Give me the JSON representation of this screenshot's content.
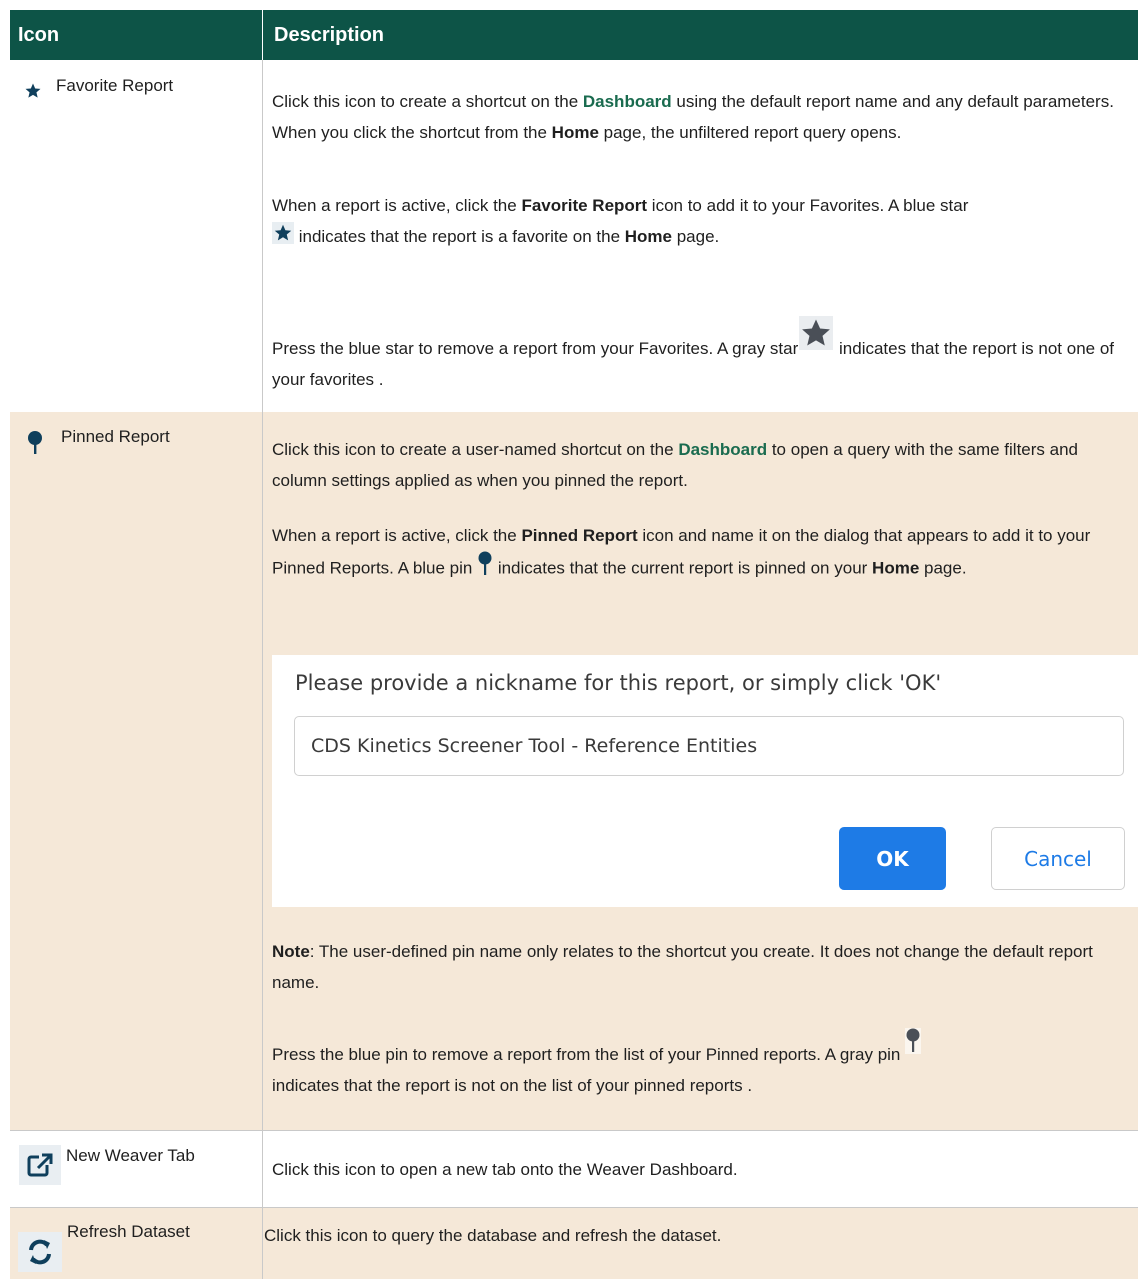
{
  "header": {
    "col_icon": "Icon",
    "col_description": "Description"
  },
  "rows": {
    "favorite": {
      "icon": "star-icon",
      "label": "Favorite Report",
      "p1_a": "Click this icon to create a shortcut on the ",
      "p1_link": "Dashboard",
      "p1_b": " using the default report name and any default parameters. When you click the shortcut from the ",
      "p1_bold": "Home",
      "p1_c": " page, the unfiltered report query opens.",
      "p2_a": "When a report is active, click the ",
      "p2_bold": "Favorite Report",
      "p2_b": " icon to add it to your Favorites. A blue star",
      "p2_c": " indicates that the report is a favorite on the ",
      "p2_bold2": "Home",
      "p2_d": " page.",
      "p3_a": "Press the blue star to remove a report from your Favorites. A gray star",
      "p3_b": " indicates that the report is not one of your favorites ."
    },
    "pinned": {
      "icon": "pin-icon",
      "label": "Pinned Report",
      "p1_a": "Click this icon to create a user-named shortcut on the ",
      "p1_link": "Dashboard",
      "p1_b": " to open a query with the same filters and column settings applied as when you pinned the report.",
      "p2_a": "When a report is active, click the ",
      "p2_bold": "Pinned Report",
      "p2_b": " icon and name it on the dialog that appears to add it to your Pinned Reports. A blue pin ",
      "p2_c": " indicates that the current report is pinned on your ",
      "p2_bold2": "Home",
      "p2_d": " page.",
      "dialog": {
        "prompt": "Please provide a nickname for this report, or simply click 'OK'",
        "input_value": "CDS Kinetics Screener Tool - Reference Entities",
        "ok_label": "OK",
        "cancel_label": "Cancel"
      },
      "note_bold": "Note",
      "note_text": ": The user-defined pin name only relates to the shortcut you create. It does not change the default report name.",
      "p4_a": "Press the blue pin to remove a report from the list of your Pinned reports. A gray pin ",
      "p4_b": "indicates that the report is not on the list of your pinned reports ."
    },
    "newtab": {
      "icon": "external-link-icon",
      "label": "New Weaver Tab",
      "desc": "Click this icon to open a new tab onto the Weaver Dashboard."
    },
    "refresh": {
      "icon": "refresh-icon",
      "label": "Refresh Dataset",
      "desc": "Click this icon to query the database and refresh the dataset."
    }
  },
  "colors": {
    "header_bg": "#0d5447",
    "alt_row_bg": "#f5e8d8",
    "link": "#1a6b4f",
    "icon_blue": "#0f3f5c",
    "icon_gray": "#4a4f57",
    "button_blue": "#1e7be6"
  }
}
